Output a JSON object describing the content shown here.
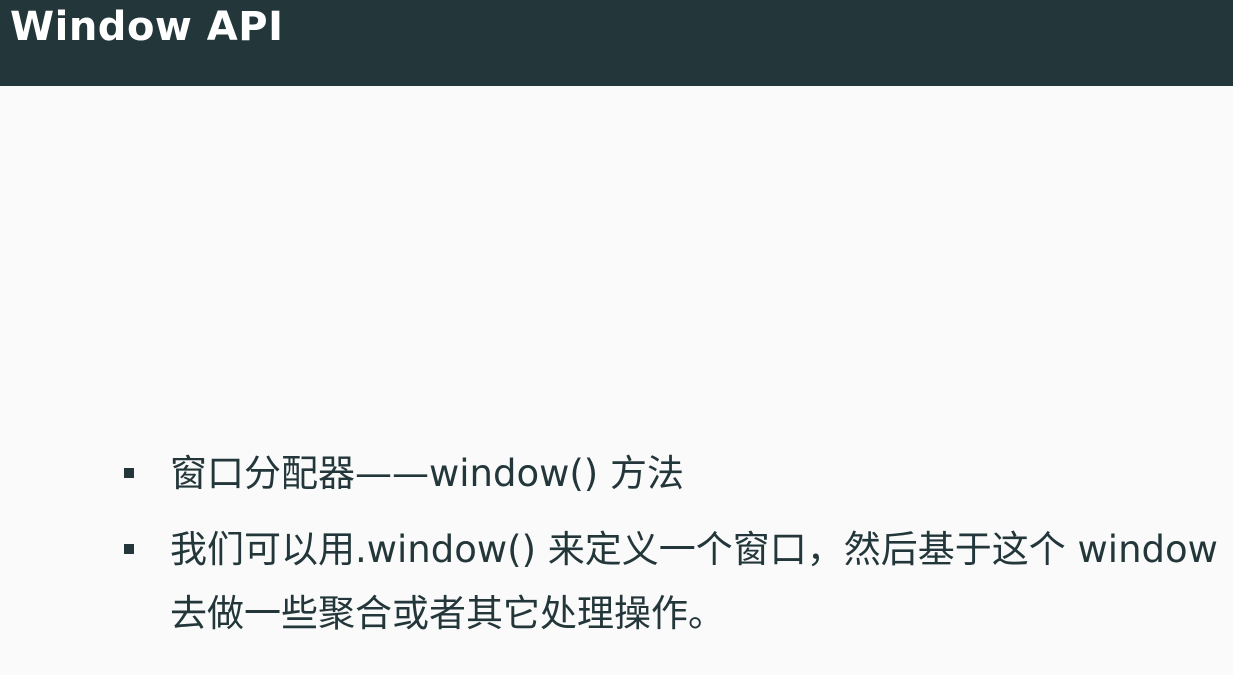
{
  "slide": {
    "title": "Window API",
    "bullets": [
      "窗口分配器——window() 方法",
      "我们可以用.window() 来定义一个窗口，然后基于这个 window 去做一些聚合或者其它处理操作。"
    ]
  },
  "colors": {
    "header_background": "#23373b",
    "body_background": "#fafafa",
    "text": "#23373b",
    "title_text": "#ffffff"
  }
}
